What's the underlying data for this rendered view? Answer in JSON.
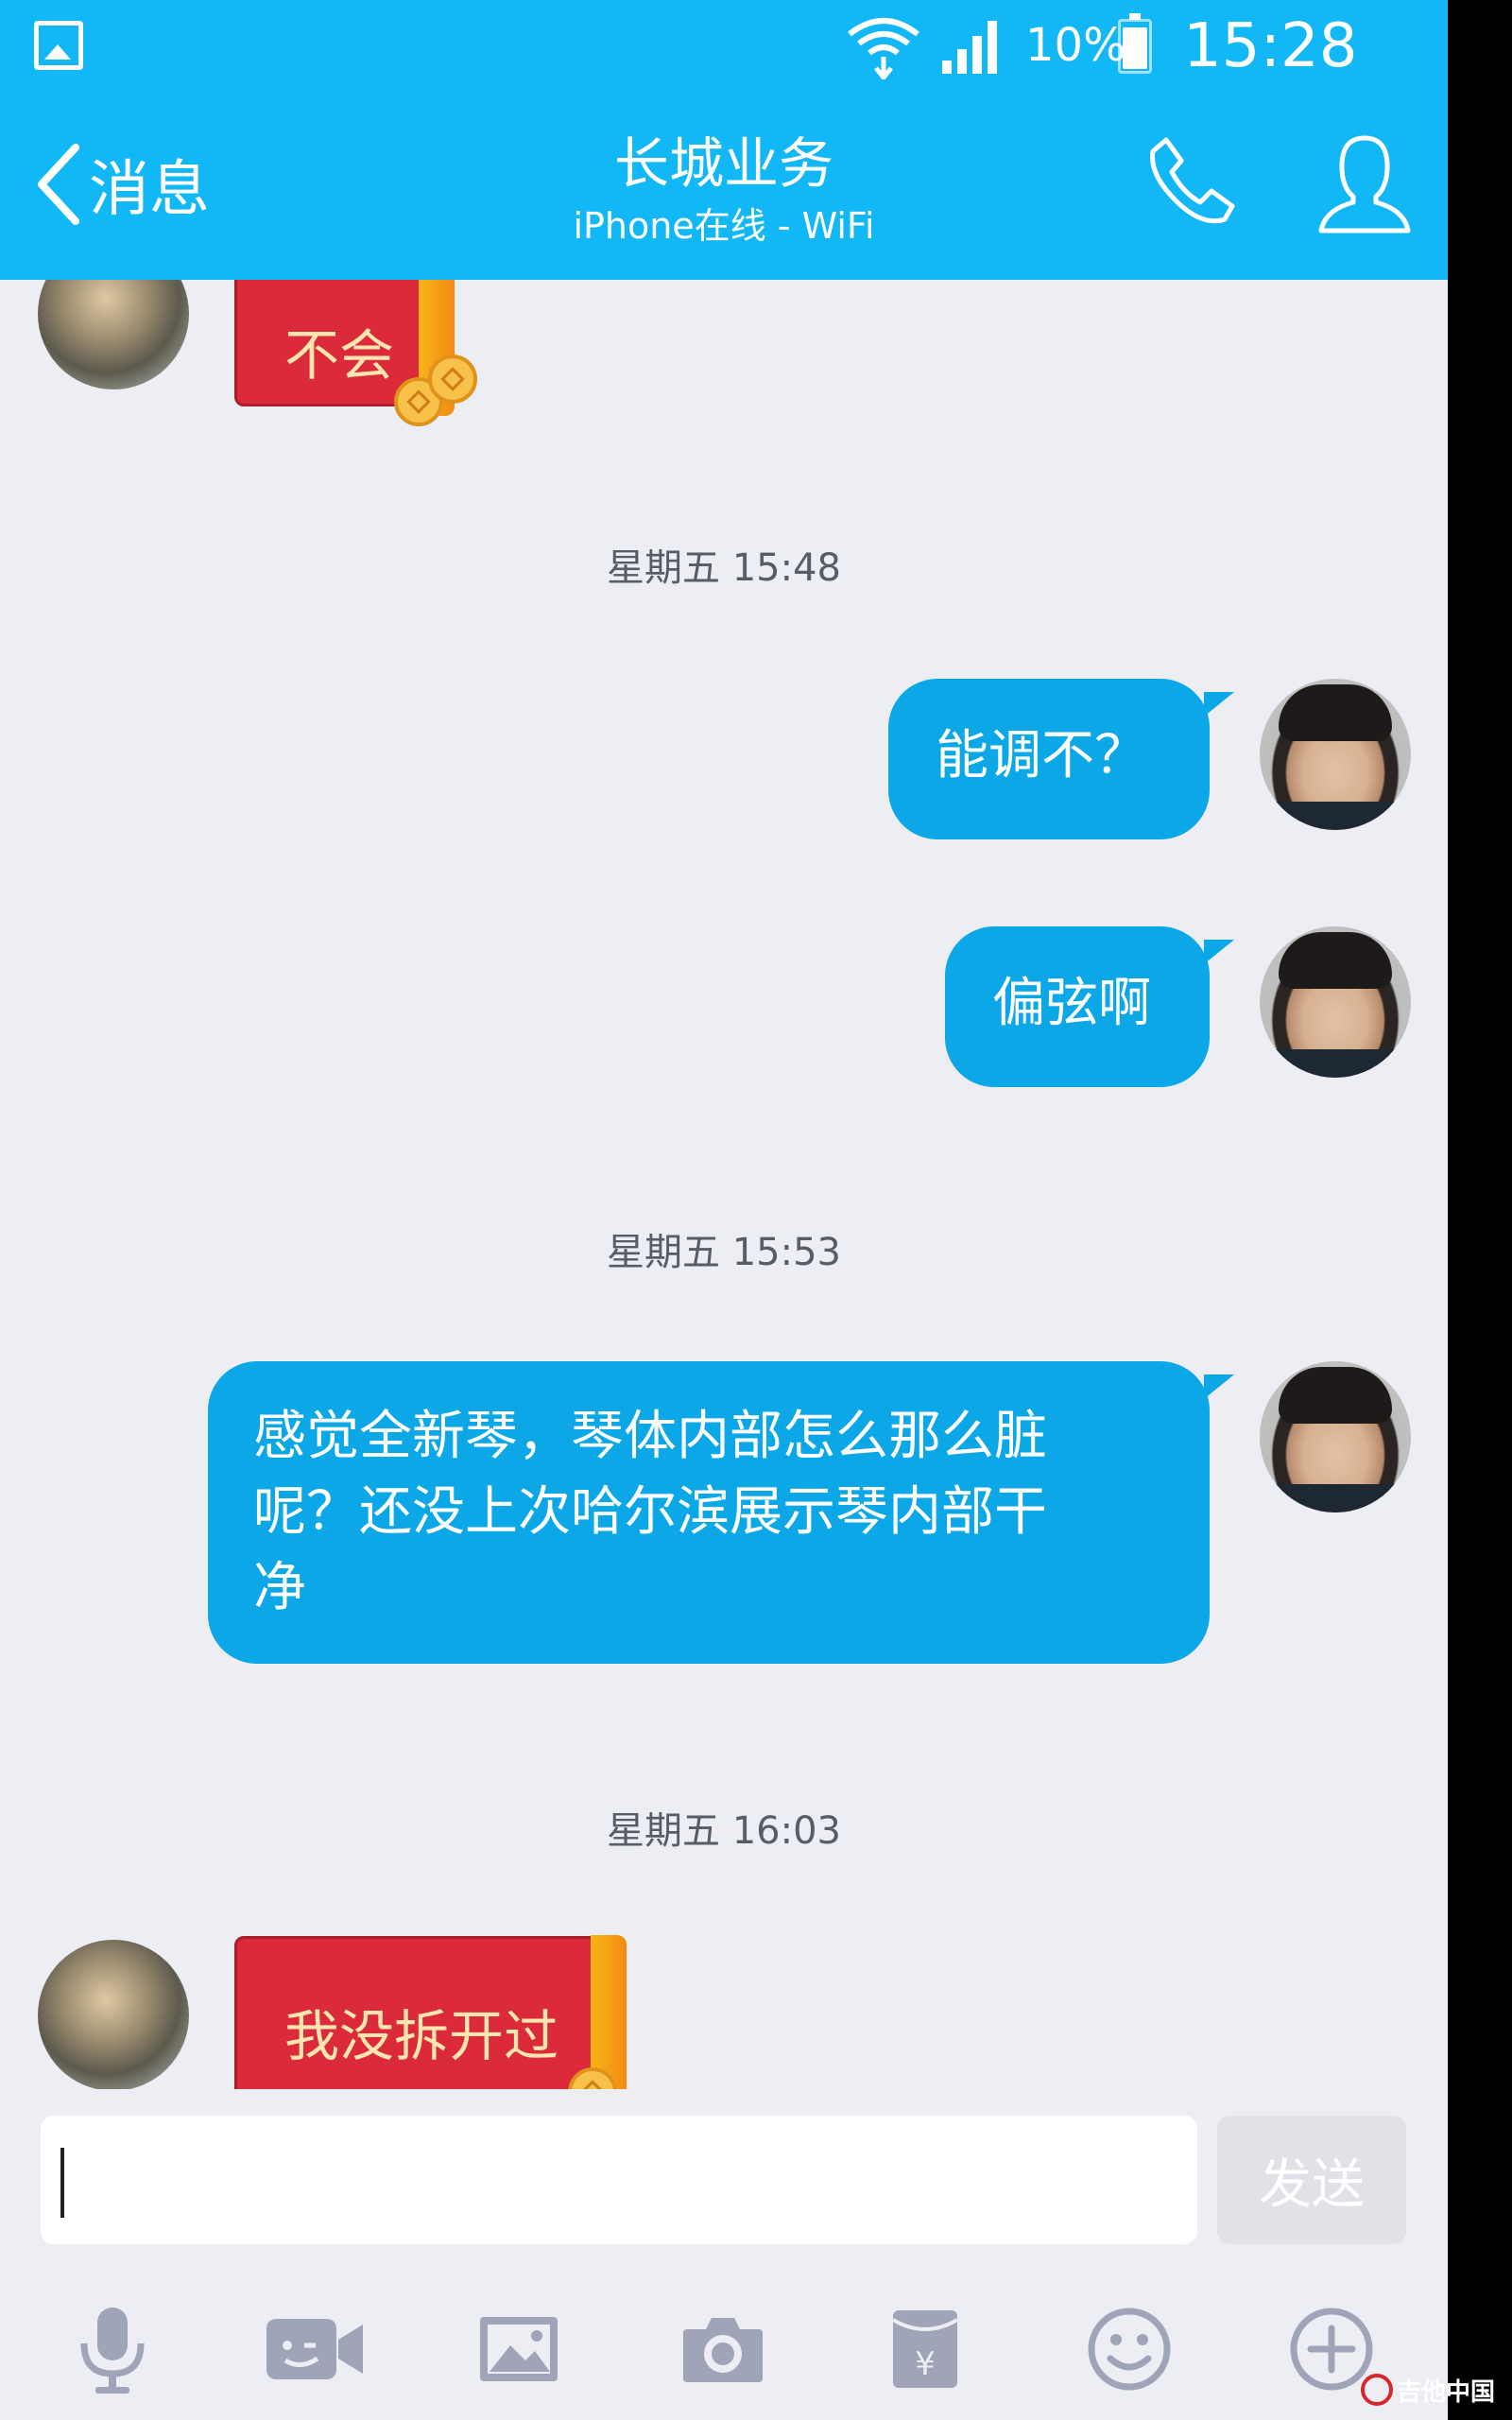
{
  "status_bar": {
    "battery_percent": "10%",
    "time": "15:28",
    "icons": [
      "gallery-icon",
      "wifi-icon",
      "signal-icon",
      "battery-icon"
    ]
  },
  "header": {
    "back_label": "消息",
    "title": "长城业务",
    "subtitle": "iPhone在线 - WiFi",
    "icons": [
      "call-icon",
      "profile-icon"
    ],
    "color": "#12B7F5"
  },
  "chat": {
    "messages": [
      {
        "type": "red_packet",
        "side": "left",
        "text": "不会"
      },
      {
        "type": "timestamp",
        "text": "星期五 15:48"
      },
      {
        "type": "bubble",
        "side": "right",
        "text": "能调不？"
      },
      {
        "type": "bubble",
        "side": "right",
        "text": "偏弦啊"
      },
      {
        "type": "timestamp",
        "text": "星期五 15:53"
      },
      {
        "type": "bubble",
        "side": "right",
        "lines": [
          "感觉全新琴，琴体内部怎么那么脏",
          "呢？还没上次哈尔滨展示琴内部干",
          "净"
        ]
      },
      {
        "type": "timestamp",
        "text": "星期五 16:03"
      },
      {
        "type": "red_packet",
        "side": "left",
        "text": "我没拆开过"
      }
    ],
    "bubble_color": "#0BA7E6",
    "red_packet_color": "#DB2A3A"
  },
  "input": {
    "value": "",
    "send_label": "发送"
  },
  "toolbar": {
    "icons": [
      "microphone-icon",
      "video-icon",
      "image-icon",
      "camera-icon",
      "red-packet-icon",
      "emoji-icon",
      "plus-icon"
    ]
  },
  "watermark": {
    "text": "吉他中国"
  }
}
